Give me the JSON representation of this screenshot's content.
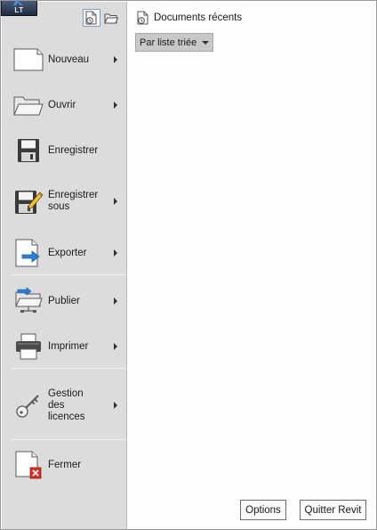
{
  "app": {
    "badge": "LT"
  },
  "menu": {
    "items": [
      {
        "id": "nouveau",
        "label": "Nouveau",
        "has_submenu": true,
        "icon": "new-document-icon"
      },
      {
        "id": "ouvrir",
        "label": "Ouvrir",
        "has_submenu": true,
        "icon": "open-folder-icon"
      },
      {
        "id": "enregistrer",
        "label": "Enregistrer",
        "has_submenu": false,
        "icon": "save-disk-icon"
      },
      {
        "id": "enregistrer-sous",
        "label": "Enregistrer sous",
        "has_submenu": true,
        "icon": "save-as-icon"
      },
      {
        "id": "exporter",
        "label": "Exporter",
        "has_submenu": true,
        "icon": "export-icon"
      },
      {
        "id": "publier",
        "label": "Publier",
        "has_submenu": true,
        "icon": "publish-icon"
      },
      {
        "id": "imprimer",
        "label": "Imprimer",
        "has_submenu": true,
        "icon": "printer-icon"
      },
      {
        "id": "gestion-licences",
        "label": "Gestion des licences",
        "has_submenu": true,
        "icon": "key-icon"
      },
      {
        "id": "fermer",
        "label": "Fermer",
        "has_submenu": false,
        "icon": "close-document-icon"
      }
    ]
  },
  "content": {
    "title": "Documents récents",
    "sort": {
      "selected": "Par liste triée"
    }
  },
  "footer": {
    "options_label": "Options",
    "quit_label": "Quitter Revit"
  },
  "colors": {
    "panel_bg": "#dcdcdc",
    "content_bg": "#fdfdfd",
    "export_arrow": "#2d7fd3",
    "close_red": "#d9312b"
  }
}
